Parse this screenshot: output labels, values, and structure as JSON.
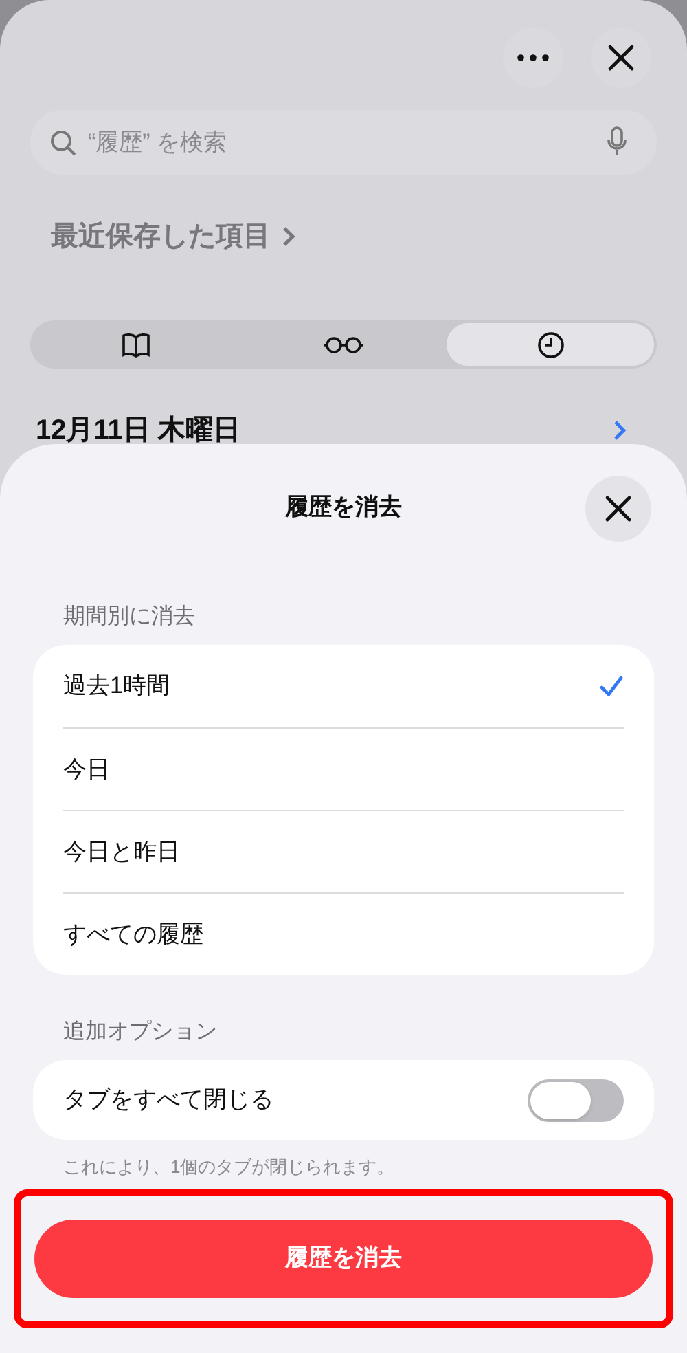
{
  "background": {
    "search": {
      "placeholder": "“履歴” を検索"
    },
    "recent_link": "最近保存した項目",
    "segments": [
      {
        "kind": "book",
        "selected": false
      },
      {
        "kind": "glasses",
        "selected": false
      },
      {
        "kind": "clock",
        "selected": true
      }
    ],
    "date_header": "12月11日 木曜日"
  },
  "sheet": {
    "title": "履歴を消去",
    "period_section": "期間別に消去",
    "periods": [
      {
        "label": "過去1時間",
        "selected": true
      },
      {
        "label": "今日",
        "selected": false
      },
      {
        "label": "今日と昨日",
        "selected": false
      },
      {
        "label": "すべての履歴",
        "selected": false
      }
    ],
    "options_section": "追加オプション",
    "option": {
      "label": "タブをすべて閉じる",
      "on": false
    },
    "note": "これにより、1個のタブが閉じられます。",
    "clear_button": {
      "label": "履歴を消去",
      "highlighted": true
    }
  }
}
